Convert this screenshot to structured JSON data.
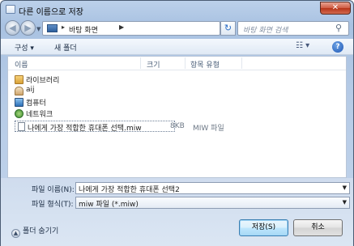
{
  "window": {
    "title": "다른 이름으로 저장",
    "close_label": "✕"
  },
  "nav": {
    "back_icon": "back-arrow-icon",
    "forward_icon": "forward-arrow-icon",
    "address_path": "바탕 화면",
    "search_placeholder": "바탕 화면 검색"
  },
  "toolbar": {
    "organize": "구성 ▾",
    "new_folder": "새 폴더",
    "help": "?"
  },
  "columns": {
    "name": "이름",
    "size": "크기",
    "type": "항목 유형"
  },
  "items": [
    {
      "label": "라이브러리",
      "icon": "library-icon"
    },
    {
      "label": "aij",
      "icon": "user-folder-icon"
    },
    {
      "label": "컴퓨터",
      "icon": "computer-icon"
    },
    {
      "label": "네트워크",
      "icon": "network-icon"
    }
  ],
  "file": {
    "name": "나에게 가장 적합한 휴대폰 선택.miw",
    "size": "8KB",
    "type": "MIW 파일"
  },
  "form": {
    "filename_label": "파일 이름(N):",
    "filename_value": "나에게 가장 적합한 휴대폰 선택2",
    "filetype_label": "파일 형식(T):",
    "filetype_value": "miw 파일 (*.miw)"
  },
  "footer": {
    "hide_folders": "폴더 숨기기",
    "save": "저장(S)",
    "cancel": "취소"
  }
}
